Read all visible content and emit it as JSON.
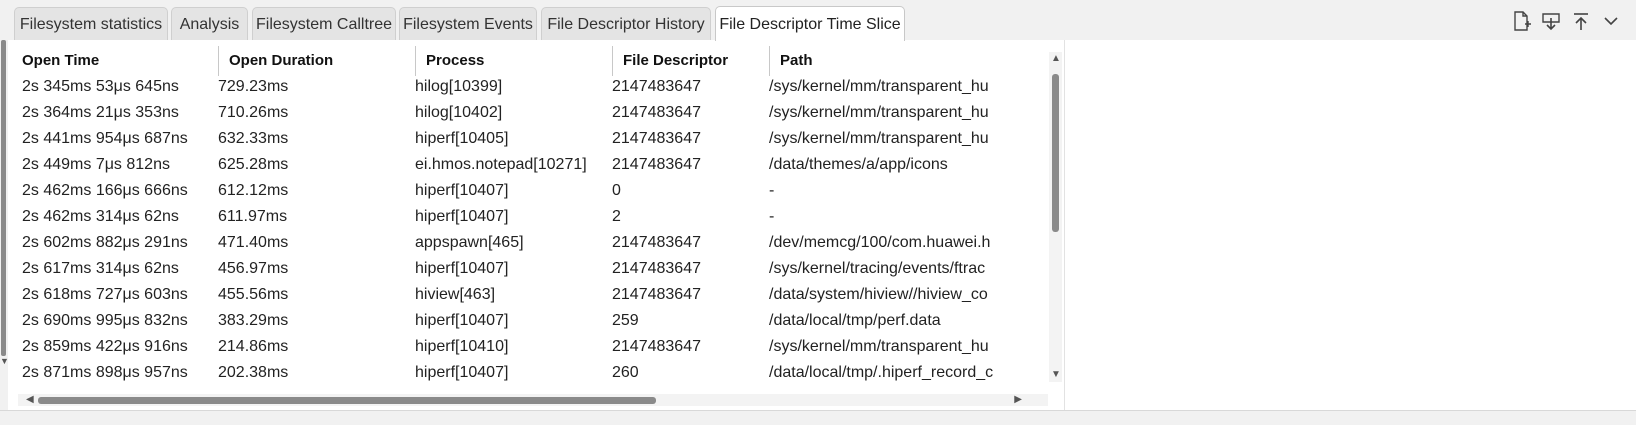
{
  "tabs": [
    {
      "label": "Filesystem statistics",
      "active": false
    },
    {
      "label": "Analysis",
      "active": false
    },
    {
      "label": "Filesystem Calltree",
      "active": false
    },
    {
      "label": "Filesystem Events",
      "active": false
    },
    {
      "label": "File Descriptor History",
      "active": false
    },
    {
      "label": "File Descriptor Time Slice",
      "active": true
    }
  ],
  "toolbar": {
    "icons": [
      "file-add-icon",
      "download-icon",
      "upload-top-icon",
      "chevron-down-icon"
    ]
  },
  "table": {
    "columns": [
      "Open Time",
      "Open Duration",
      "Process",
      "File Descriptor",
      "Path"
    ],
    "rows": [
      [
        "2s 345ms 53μs 645ns",
        "729.23ms",
        "hilog[10399]",
        "2147483647",
        "/sys/kernel/mm/transparent_hu"
      ],
      [
        "2s 364ms 21μs 353ns",
        "710.26ms",
        "hilog[10402]",
        "2147483647",
        "/sys/kernel/mm/transparent_hu"
      ],
      [
        "2s 441ms 954μs 687ns",
        "632.33ms",
        "hiperf[10405]",
        "2147483647",
        "/sys/kernel/mm/transparent_hu"
      ],
      [
        "2s 449ms 7μs 812ns",
        "625.28ms",
        "ei.hmos.notepad[10271]",
        "2147483647",
        "/data/themes/a/app/icons"
      ],
      [
        "2s 462ms 166μs 666ns",
        "612.12ms",
        "hiperf[10407]",
        "0",
        "-"
      ],
      [
        "2s 462ms 314μs 62ns",
        "611.97ms",
        "hiperf[10407]",
        "2",
        "-"
      ],
      [
        "2s 602ms 882μs 291ns",
        "471.40ms",
        "appspawn[465]",
        "2147483647",
        "/dev/memcg/100/com.huawei.h"
      ],
      [
        "2s 617ms 314μs 62ns",
        "456.97ms",
        "hiperf[10407]",
        "2147483647",
        "/sys/kernel/tracing/events/ftrac"
      ],
      [
        "2s 618ms 727μs 603ns",
        "455.56ms",
        "hiview[463]",
        "2147483647",
        "/data/system/hiview//hiview_co"
      ],
      [
        "2s 690ms 995μs 832ns",
        "383.29ms",
        "hiperf[10407]",
        "259",
        "/data/local/tmp/perf.data"
      ],
      [
        "2s 859ms 422μs 916ns",
        "214.86ms",
        "hiperf[10410]",
        "2147483647",
        "/sys/kernel/mm/transparent_hu"
      ],
      [
        "2s 871ms 898μs 957ns",
        "202.38ms",
        "hiperf[10407]",
        "260",
        "/data/local/tmp/.hiperf_record_c"
      ]
    ]
  }
}
